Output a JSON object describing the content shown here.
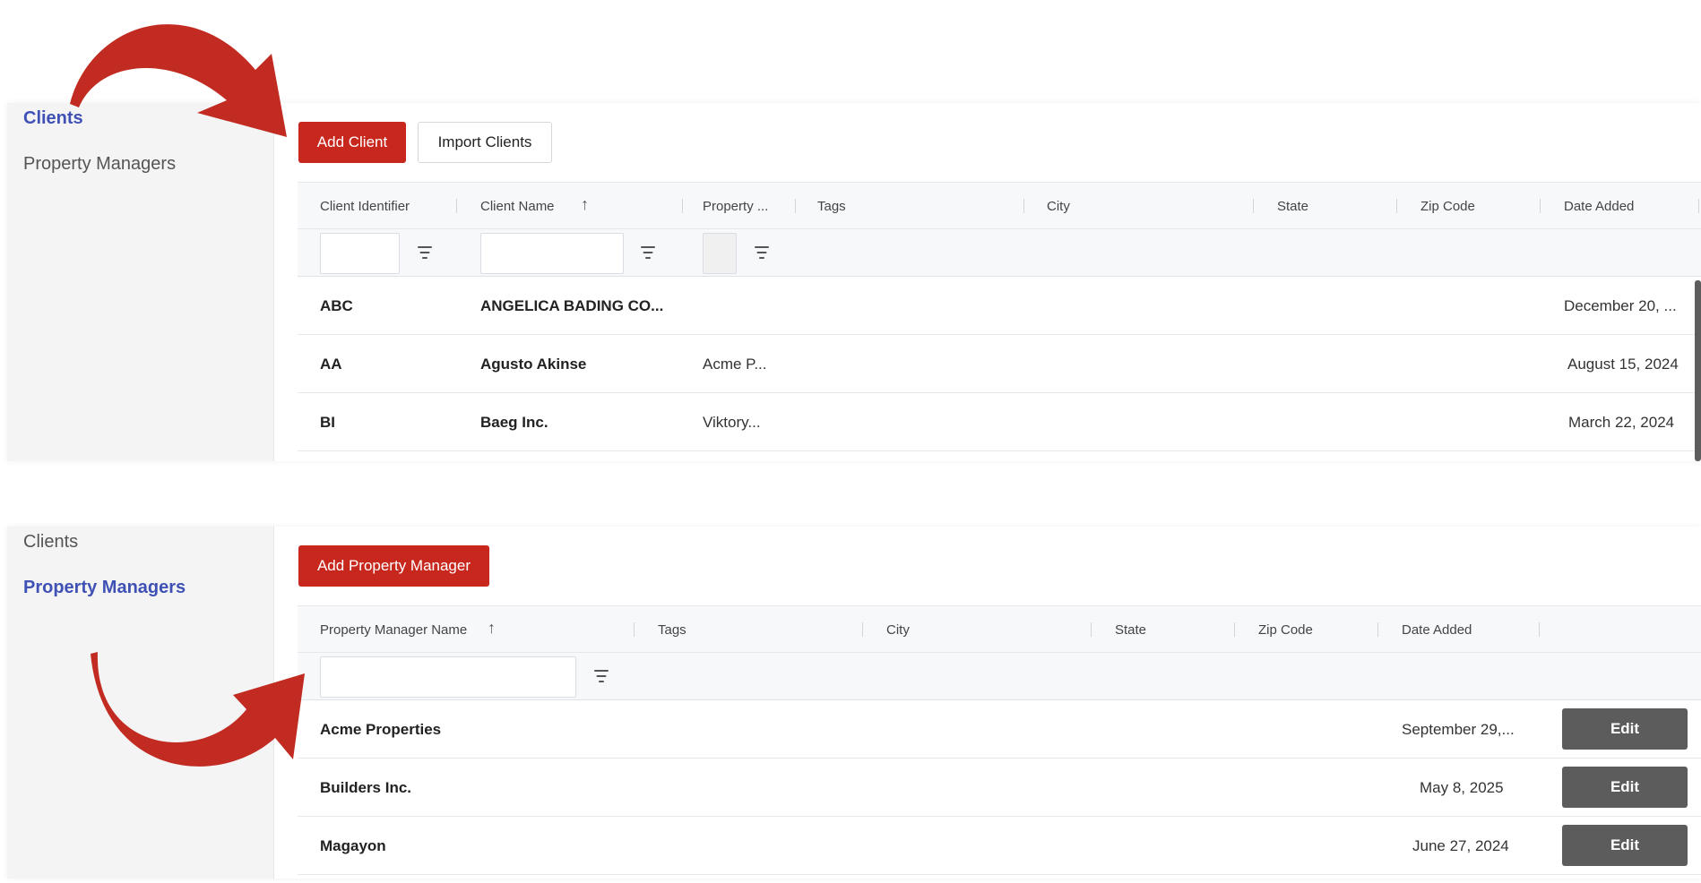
{
  "clients_view": {
    "sidebar": {
      "items": [
        {
          "label": "Clients",
          "active": true
        },
        {
          "label": "Property Managers",
          "active": false
        }
      ]
    },
    "actions": {
      "add_label": "Add Client",
      "import_label": "Import Clients"
    },
    "columns": [
      "Client Identifier",
      "Client Name",
      "Property ...",
      "Tags",
      "City",
      "State",
      "Zip Code",
      "Date Added"
    ],
    "sorted_column": "Client Name",
    "sort_direction": "ascending",
    "rows": [
      {
        "identifier": "ABC",
        "name": "ANGELICA BADING CO...",
        "property": "",
        "date_added": "December 20, ..."
      },
      {
        "identifier": "AA",
        "name": "Agusto Akinse",
        "property": "Acme P...",
        "date_added": "August 15, 2024"
      },
      {
        "identifier": "BI",
        "name": "Baeg Inc.",
        "property": "Viktory...",
        "date_added": "March 22, 2024"
      }
    ]
  },
  "managers_view": {
    "sidebar": {
      "items": [
        {
          "label": "Clients",
          "active": false
        },
        {
          "label": "Property Managers",
          "active": true
        }
      ]
    },
    "actions": {
      "add_label": "Add Property Manager"
    },
    "columns": [
      "Property Manager Name",
      "Tags",
      "City",
      "State",
      "Zip Code",
      "Date Added"
    ],
    "sorted_column": "Property Manager Name",
    "sort_direction": "ascending",
    "rows": [
      {
        "name": "Acme Properties",
        "date_added": "September 29,...",
        "action_label": "Edit"
      },
      {
        "name": "Builders Inc.",
        "date_added": "May 8, 2025",
        "action_label": "Edit"
      },
      {
        "name": "Magayon",
        "date_added": "June 27, 2024",
        "action_label": "Edit"
      }
    ]
  },
  "colors": {
    "accent_red": "#c8271e",
    "active_link": "#3f51b5",
    "edit_button": "#5c5c5c"
  },
  "annotations": [
    "curved-red-arrow",
    "curved-red-arrow"
  ]
}
